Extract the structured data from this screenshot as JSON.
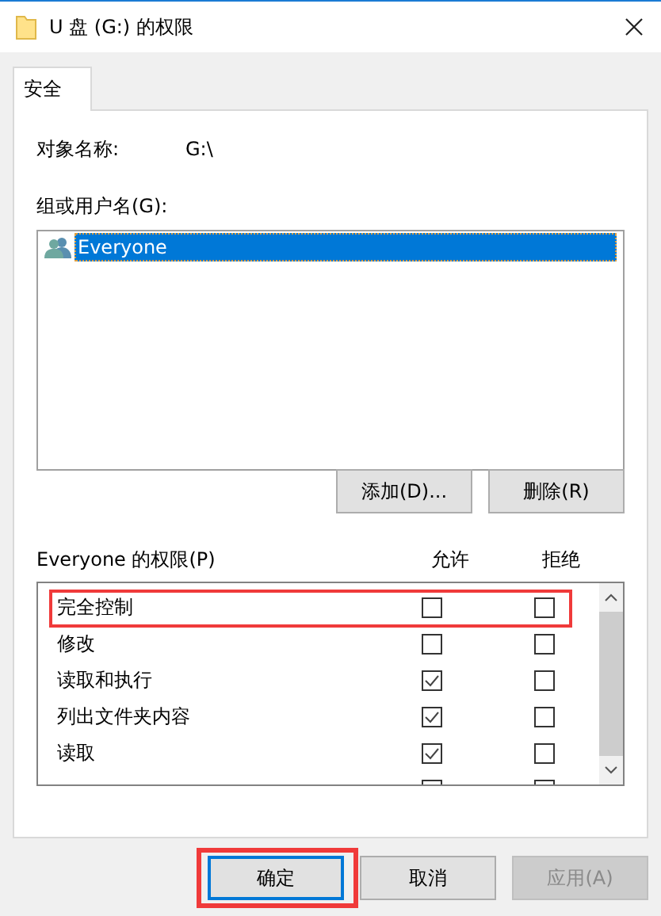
{
  "window": {
    "title": "U 盘 (G:) 的权限"
  },
  "tabs": [
    {
      "label": "安全",
      "selected": true
    }
  ],
  "object": {
    "label": "对象名称:",
    "value": "G:\\"
  },
  "users": {
    "label": "组或用户名(G):",
    "items": [
      {
        "name": "Everyone",
        "selected": true
      }
    ]
  },
  "user_buttons": [
    "添加(D)...",
    "删除(R)"
  ],
  "permissions": {
    "label": "Everyone 的权限(P)",
    "columns": [
      "允许",
      "拒绝"
    ],
    "rows": [
      {
        "name": "完全控制",
        "allow": false,
        "deny": false,
        "highlighted": true
      },
      {
        "name": "修改",
        "allow": false,
        "deny": false,
        "highlighted": false
      },
      {
        "name": "读取和执行",
        "allow": true,
        "deny": false,
        "highlighted": false
      },
      {
        "name": "列出文件夹内容",
        "allow": true,
        "deny": false,
        "highlighted": false
      },
      {
        "name": "读取",
        "allow": true,
        "deny": false,
        "highlighted": false
      }
    ]
  },
  "buttons": [
    {
      "label": "确定",
      "default": true,
      "disabled": false,
      "highlighted": true
    },
    {
      "label": "取消",
      "default": false,
      "disabled": false,
      "highlighted": false
    },
    {
      "label": "应用(A)",
      "default": false,
      "disabled": true,
      "highlighted": false
    }
  ]
}
